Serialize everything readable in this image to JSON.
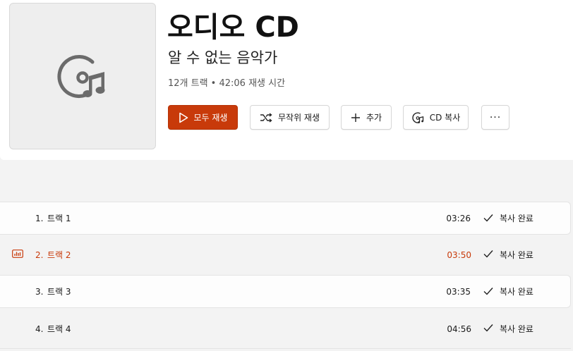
{
  "album": {
    "title": "오디오 CD",
    "artist": "알 수 없는 음악가",
    "meta": "12개 트랙 • 42:06 재생 시간",
    "art_icon": "music-disc-icon"
  },
  "actions": {
    "play_all": "모두 재생",
    "shuffle": "무작위 재생",
    "add": "추가",
    "rip": "CD 복사",
    "more": "···"
  },
  "colors": {
    "accent": "#c83a0a"
  },
  "tracks": [
    {
      "num": "1.",
      "title": "트랙 1",
      "duration": "03:26",
      "status": "복사 완료"
    },
    {
      "num": "2.",
      "title": "트랙 2",
      "duration": "03:50",
      "status": "복사 완료",
      "playing": true
    },
    {
      "num": "3.",
      "title": "트랙 3",
      "duration": "03:35",
      "status": "복사 완료"
    },
    {
      "num": "4.",
      "title": "트랙 4",
      "duration": "04:56",
      "status": "복사 완료"
    }
  ]
}
